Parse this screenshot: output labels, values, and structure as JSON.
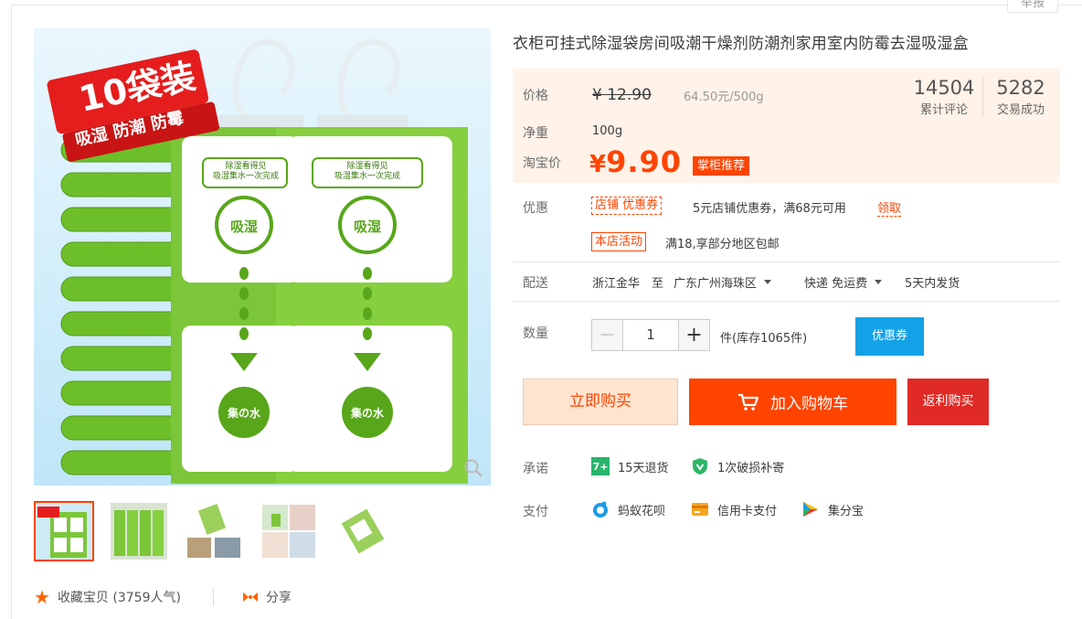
{
  "top": {
    "report_label": "举报"
  },
  "gallery": {
    "main_banner": "10袋装",
    "main_tagline": "吸湿 防潮 防霉",
    "pack_caption_line1": "除湿看得见",
    "pack_caption_line2": "吸湿集水一次完成",
    "pack_circle_text": "吸湿",
    "pack_bottom_text": "集の水",
    "thumb_count": 5
  },
  "favorite": {
    "label": "收藏宝贝 (3759人气)"
  },
  "share": {
    "label": "分享"
  },
  "product": {
    "title": "衣柜可挂式除湿袋房间吸潮干燥剂防潮剂家用室内防霉去湿吸湿盒",
    "price_label": "价格",
    "original_price": "¥ 12.90",
    "unit_price": "64.50元/500g",
    "review_count": "14504",
    "review_label": "累计评论",
    "deal_count": "5282",
    "deal_label": "交易成功",
    "net_weight_label": "净重",
    "net_weight": "100g",
    "taobao_price_label": "淘宝价",
    "currency": "¥",
    "taobao_price": "9.90",
    "recommend_tag": "掌柜推荐"
  },
  "promo": {
    "label": "优惠",
    "coupon_badge": "店铺 优惠券",
    "coupon_text": "5元店铺优惠券，满68元可用",
    "coupon_get": "领取",
    "activity_badge": "本店活动",
    "activity_text": "满18,享部分地区包邮"
  },
  "delivery": {
    "label": "配送",
    "from": "浙江金华",
    "to_word": "至",
    "to": "广东广州海珠区",
    "method": "快递 免运费",
    "ship_time": "5天内发货"
  },
  "quantity": {
    "label": "数量",
    "minus": "−",
    "value": "1",
    "plus": "+",
    "stock": "件(库存1065件)",
    "coupon_button": "优惠券"
  },
  "actions": {
    "buy_now": "立即购买",
    "add_to_cart": "加入购物车",
    "rebate_buy": "返利购买"
  },
  "promise": {
    "label": "承诺",
    "item1_icon_text": "7+",
    "item1": "15天退货",
    "item2": "1次破损补寄"
  },
  "payment": {
    "label": "支付",
    "item1": "蚂蚁花呗",
    "item2": "信用卡支付",
    "item3": "集分宝"
  },
  "colors": {
    "accent": "#ff4400",
    "price_bg": "#fff2e8",
    "coupon_blue": "#13a2e8",
    "rebate_red": "#e02a25"
  }
}
